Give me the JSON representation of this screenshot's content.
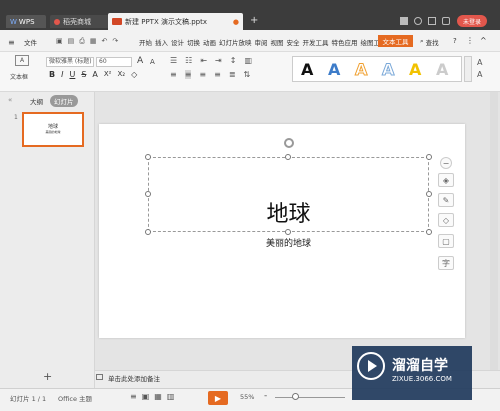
{
  "titlebar": {
    "tabs": [
      {
        "label": "WPS"
      },
      {
        "label": "稻壳商城"
      },
      {
        "label": "新建 PPTX 演示文稿.pptx"
      }
    ],
    "add_tab": "+",
    "unlogged": "未登录"
  },
  "menubar": {
    "file": "文件",
    "items": [
      "开始",
      "插入",
      "设计",
      "切换",
      "动画",
      "幻灯片放映",
      "审阅",
      "视图",
      "安全",
      "开发工具",
      "特色应用",
      "绘图工具",
      "文本工具"
    ],
    "search": "查找",
    "help": "?"
  },
  "ribbon": {
    "textbox_label": "文本框",
    "font_name": "微软雅黑 (标题)",
    "font_size": "60",
    "bold": "B",
    "italic": "I",
    "underline": "U",
    "strike": "S",
    "font_grow": "A",
    "font_shrink": "A",
    "style_letters": [
      "A",
      "A",
      "A",
      "A",
      "A",
      "A"
    ],
    "style_colors": [
      "#111111",
      "#3d7cc9",
      "#f0a030",
      "#7aa8d8",
      "#f2c200",
      "#cccccc"
    ]
  },
  "left_panel": {
    "tabs": [
      "大纲",
      "幻灯片"
    ],
    "slide_number": "1",
    "add_slide": "+"
  },
  "slide": {
    "title": "地球",
    "subtitle": "美丽的地球"
  },
  "notes": {
    "placeholder": "单击此处添加备注"
  },
  "statusbar": {
    "slide_info": "幻灯片 1 / 1",
    "theme": "Office 主题",
    "zoom": "55%",
    "zoom_minus": "-",
    "zoom_plus": "+"
  },
  "watermark": {
    "brand": "溜溜自学",
    "url": "ZIXUE.3066.COM"
  }
}
